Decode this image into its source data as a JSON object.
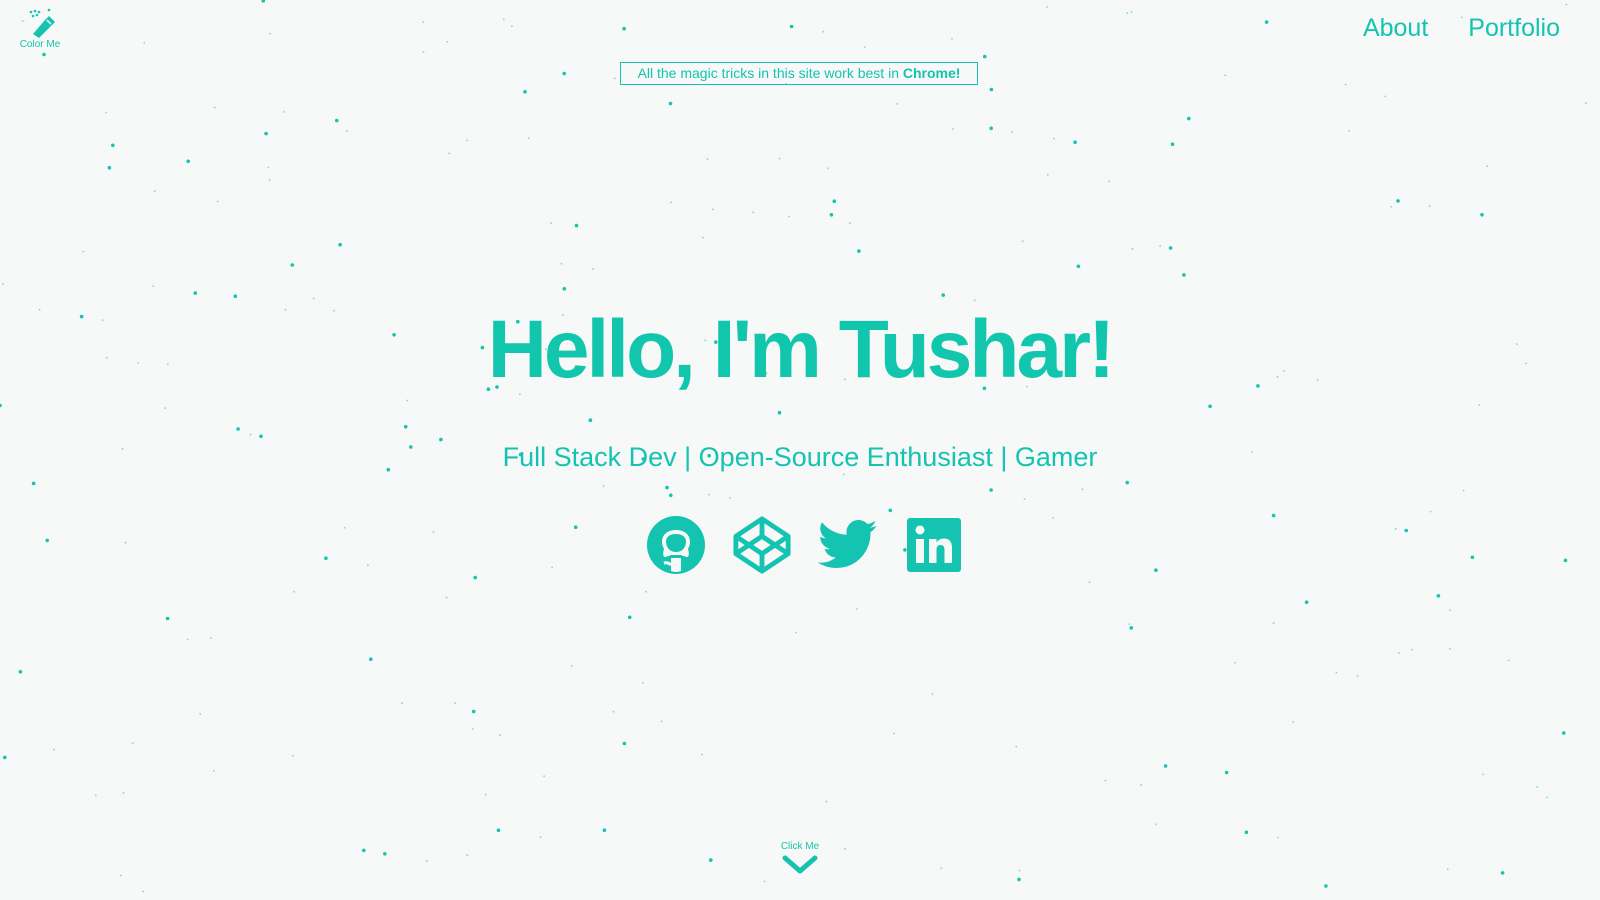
{
  "color_me": {
    "label": "Color Me",
    "icon": "magic-wand-icon"
  },
  "nav": {
    "about": "About",
    "portfolio": "Portfolio"
  },
  "notice": {
    "text": "All the magic tricks in this site work best in ",
    "highlight": "Chrome!"
  },
  "hero": {
    "title": "Hello, I'm Tushar!",
    "tagline": "Full Stack Dev | Open-Source Enthusiast | Gamer"
  },
  "socials": [
    {
      "name": "github",
      "icon": "github-icon"
    },
    {
      "name": "codepen",
      "icon": "codepen-icon"
    },
    {
      "name": "twitter",
      "icon": "twitter-icon"
    },
    {
      "name": "linkedin",
      "icon": "linkedin-icon"
    }
  ],
  "scroll": {
    "label": "Click Me",
    "icon": "chevron-down-icon"
  },
  "colors": {
    "accent": "#14c4b0",
    "background": "#f7f8f8"
  }
}
